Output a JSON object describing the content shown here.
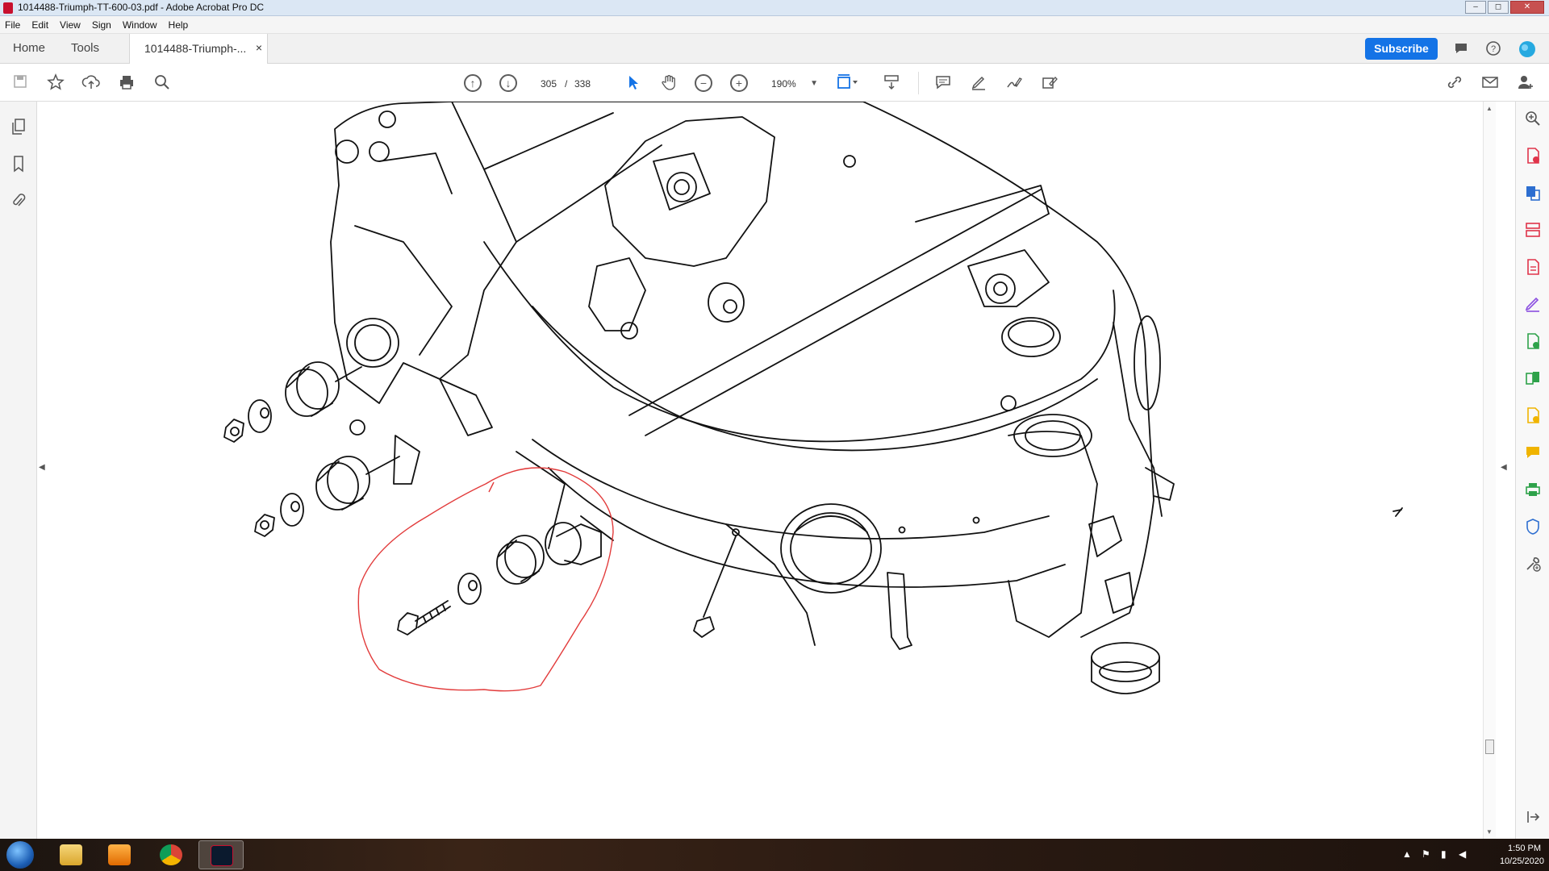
{
  "window": {
    "title": "1014488-Triumph-TT-600-03.pdf - Adobe Acrobat Pro DC",
    "controls": [
      "–",
      "◻",
      "✕"
    ]
  },
  "menu": [
    "File",
    "Edit",
    "View",
    "Sign",
    "Window",
    "Help"
  ],
  "tabs": {
    "home": "Home",
    "tools": "Tools",
    "document": "1014488-Triumph-...",
    "close_glyph": "×"
  },
  "header": {
    "subscribe_label": "Subscribe",
    "icons": [
      "comment-icon",
      "help-icon",
      "account-icon"
    ]
  },
  "toolbar": {
    "current_page": "305",
    "page_separator": "/",
    "total_pages": "338",
    "zoom": "190%"
  },
  "right_tools": [
    "search-zoom-icon",
    "create-pdf-icon",
    "export-pdf-icon",
    "organize-pages-icon",
    "edit-pdf-icon",
    "fill-sign-icon",
    "combine-files-icon",
    "compare-icon",
    "send-for-review-icon",
    "comment-icon",
    "print-production-icon",
    "protect-icon",
    "more-tools-icon"
  ],
  "document": {
    "content": "Exploded technical line drawing of motorcycle frame with mounting hardware; fasteners circled in red"
  },
  "taskbar": {
    "time": "1:50 PM",
    "date": "10/25/2020",
    "apps": [
      "file-explorer-icon",
      "media-player-icon",
      "chrome-icon",
      "acrobat-icon"
    ]
  },
  "colors": {
    "accent": "#1473e6",
    "annotation": "#e23b3b",
    "tool_red": "#e0344a",
    "tool_blue": "#2d6ed0",
    "tool_green": "#2ea24a",
    "tool_yellow": "#f0b400",
    "tool_purple": "#8a4ee0"
  }
}
